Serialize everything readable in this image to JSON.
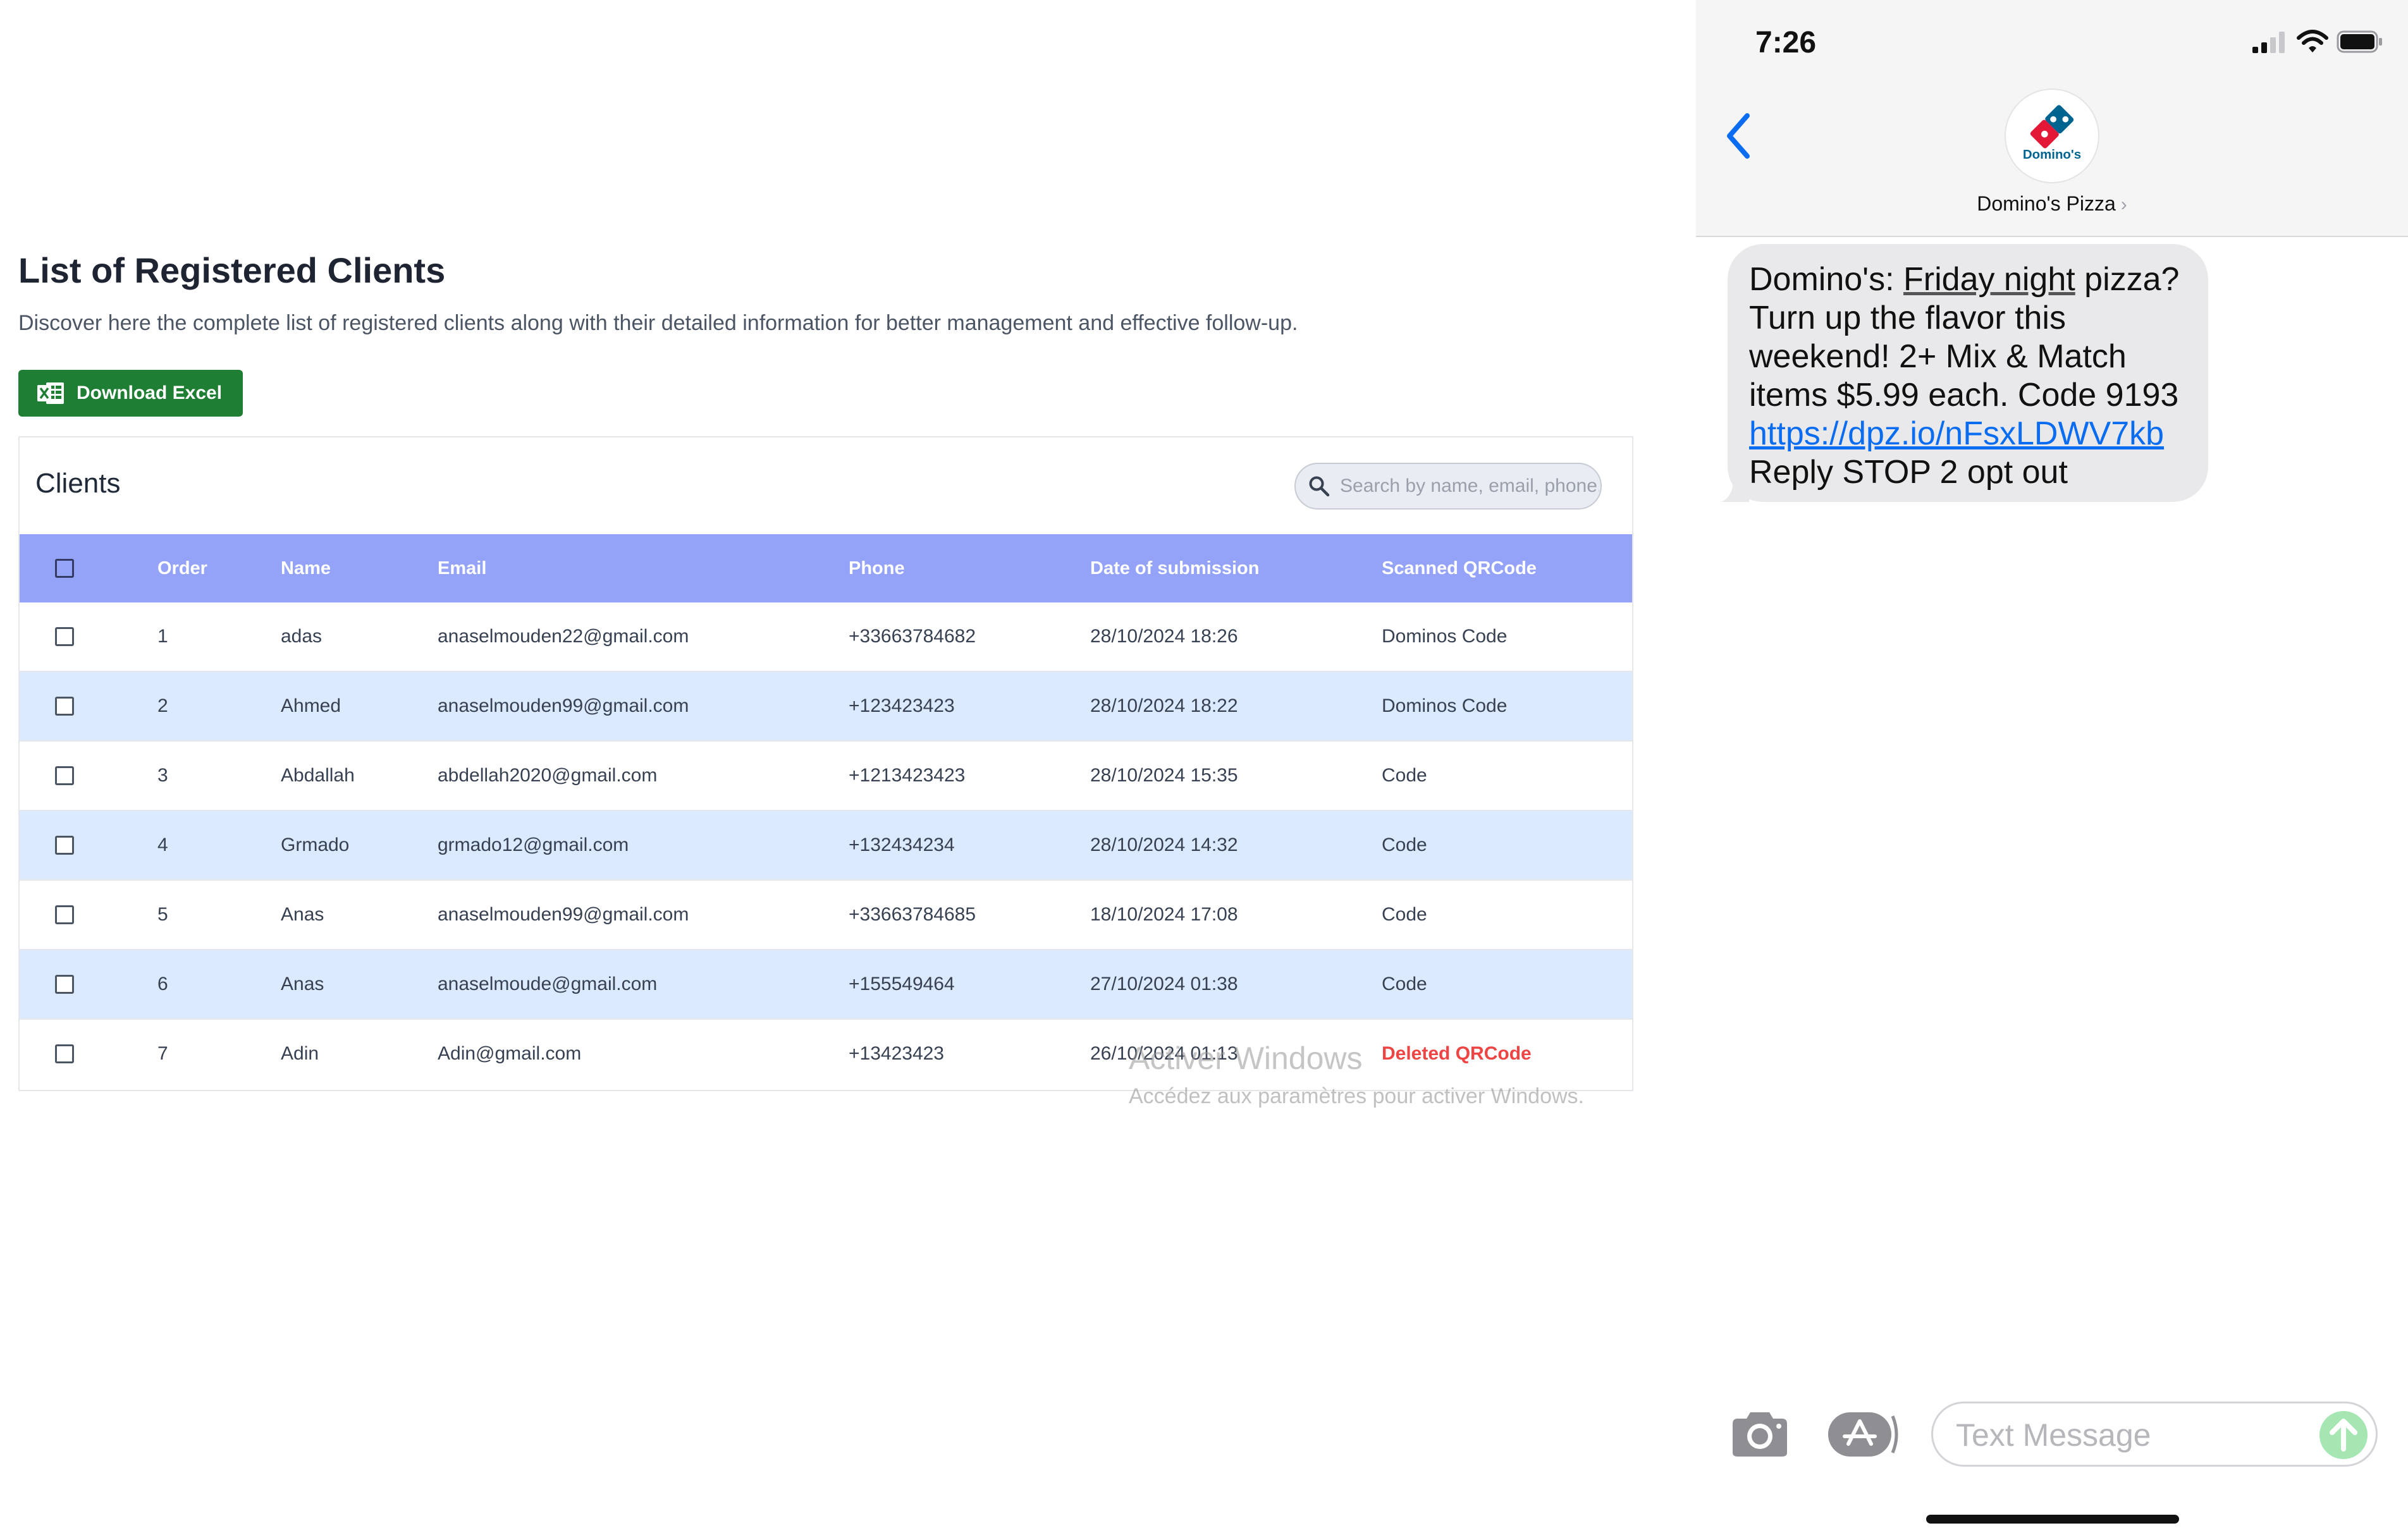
{
  "webpage": {
    "title": "List of Registered Clients",
    "description": "Discover here the complete list of registered clients along with their detailed information for better management and effective follow-up.",
    "download_button": "Download Excel",
    "card_title": "Clients",
    "search_placeholder": "Search by name, email, phone...",
    "columns": [
      "Order",
      "Name",
      "Email",
      "Phone",
      "Date of submission",
      "Scanned QRCode"
    ],
    "rows": [
      {
        "order": "1",
        "name": "adas",
        "email": "anaselmouden22@gmail.com",
        "phone": "+33663784682",
        "date": "28/10/2024 18:26",
        "qrcode": "Dominos Code",
        "deleted": false
      },
      {
        "order": "2",
        "name": "Ahmed",
        "email": "anaselmouden99@gmail.com",
        "phone": "+123423423",
        "date": "28/10/2024 18:22",
        "qrcode": "Dominos Code",
        "deleted": false
      },
      {
        "order": "3",
        "name": "Abdallah",
        "email": "abdellah2020@gmail.com",
        "phone": "+1213423423",
        "date": "28/10/2024 15:35",
        "qrcode": "Code",
        "deleted": false
      },
      {
        "order": "4",
        "name": "Grmado",
        "email": "grmado12@gmail.com",
        "phone": "+132434234",
        "date": "28/10/2024 14:32",
        "qrcode": "Code",
        "deleted": false
      },
      {
        "order": "5",
        "name": "Anas",
        "email": "anaselmouden99@gmail.com",
        "phone": "+33663784685",
        "date": "18/10/2024 17:08",
        "qrcode": "Code",
        "deleted": false
      },
      {
        "order": "6",
        "name": "Anas",
        "email": "anaselmoude@gmail.com",
        "phone": "+155549464",
        "date": "27/10/2024 01:38",
        "qrcode": "Code",
        "deleted": false
      },
      {
        "order": "7",
        "name": "Adin",
        "email": "Adin@gmail.com",
        "phone": "+13423423",
        "date": "26/10/2024 01:13",
        "qrcode": "Deleted QRCode",
        "deleted": true
      }
    ],
    "watermark": {
      "line1": "Activer Windows",
      "line2": "Accédez aux paramètres pour activer Windows."
    },
    "colors": {
      "header_bg": "#94a3f8",
      "alt_row_bg": "#dbeafe",
      "excel_green": "#1e7e34",
      "deleted_red": "#ef4444"
    }
  },
  "phone": {
    "time": "7:26",
    "contact_name": "Domino's Pizza",
    "avatar_brand_text": "Domino's",
    "message": {
      "part1": "Domino's: ",
      "underlined": "Friday night",
      "part2": " pizza? Turn up the flavor this weekend! 2+ Mix & Match items $5.99 each. Code 9193",
      "link": "https://dpz.io/nFsxLDWV7kb",
      "part3": "Reply STOP 2 opt out"
    },
    "input_placeholder": "Text Message",
    "icons": [
      "signal-icon",
      "wifi-icon",
      "battery-icon",
      "back-chevron-icon",
      "camera-icon",
      "app-store-icon",
      "send-arrow-icon"
    ],
    "colors": {
      "link_blue": "#0a6cf1",
      "bubble_bg": "#e9e9eb",
      "send_green": "#34c759",
      "dominos_blue": "#006491",
      "dominos_red": "#e31837"
    }
  }
}
